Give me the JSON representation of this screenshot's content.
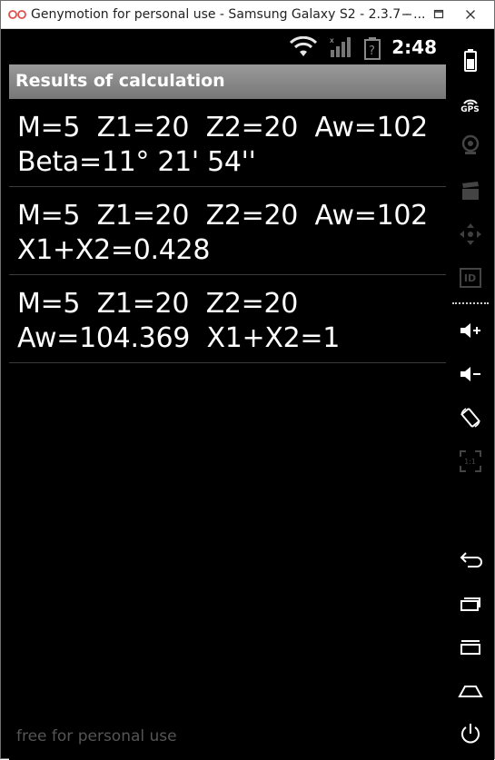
{
  "window": {
    "title": "Genymotion for personal use - Samsung Galaxy S2 - 2.3.7 - ..."
  },
  "statusbar": {
    "time": "2:48"
  },
  "app": {
    "title": "Results of calculation"
  },
  "results": [
    {
      "line1": "M=5  Z1=20  Z2=20  Aw=102",
      "line2": "Beta=11° 21' 54''"
    },
    {
      "line1": "M=5  Z1=20  Z2=20  Aw=102",
      "line2": "X1+X2=0.428"
    },
    {
      "line1": "M=5  Z1=20  Z2=20",
      "line2": "Aw=104.369  X1+X2=1"
    }
  ],
  "watermark": "free for personal use",
  "toolbar": {
    "gps_label": "GPS",
    "id_label": "ID",
    "pixel_label": "1:1"
  }
}
